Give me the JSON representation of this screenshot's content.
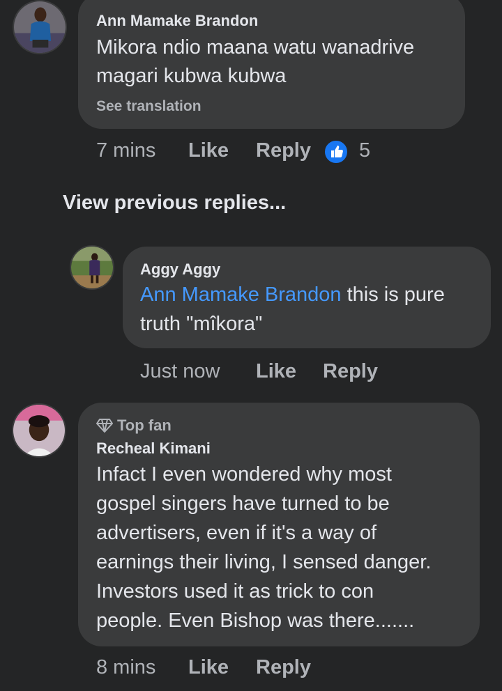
{
  "comments": [
    {
      "author": "Ann Mamake Brandon",
      "text_lines": [
        "Mikora ndio maana watu wanadrive",
        "magari kubwa kubwa"
      ],
      "see_translation": "See translation",
      "time": "7 mins",
      "like_label": "Like",
      "reply_label": "Reply",
      "reaction_icon": "thumbs-up-icon",
      "reaction_count": "5"
    },
    {
      "author": "Aggy Aggy",
      "mention": "Ann Mamake Brandon",
      "text_line1_rest": " this is pure",
      "text_line2": "truth \"mîkora\"",
      "time": "Just now",
      "like_label": "Like",
      "reply_label": "Reply"
    },
    {
      "badge_icon": "diamond-icon",
      "badge": "Top fan",
      "author": "Recheal Kimani",
      "text_lines": [
        "Infact I even wondered why most",
        "gospel singers have turned to be",
        "advertisers, even if it's a way of",
        "earnings their living, I sensed danger.",
        "Investors used it as trick to con",
        "people. Even Bishop was there......."
      ],
      "time": "8 mins",
      "like_label": "Like",
      "reply_label": "Reply"
    }
  ],
  "view_previous_replies": "View previous replies...",
  "colors": {
    "background": "#242526",
    "bubble": "#3a3b3c",
    "primary_text": "#e4e6eb",
    "secondary_text": "#b0b3b8",
    "mention": "#4599ff",
    "like_blue": "#1877f2"
  }
}
